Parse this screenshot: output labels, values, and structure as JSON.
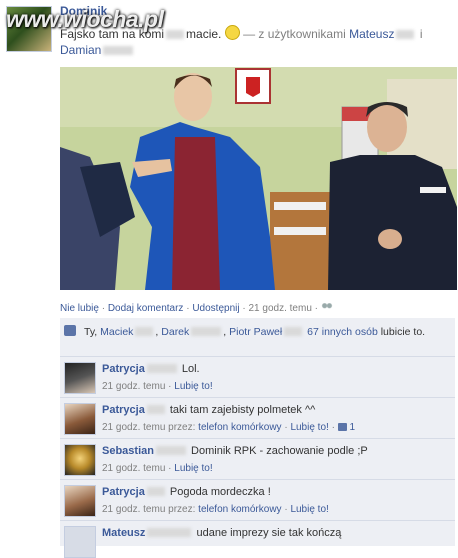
{
  "watermark": "www.wiocha.pl",
  "post": {
    "author": "Dominik",
    "text_start": "Fajsko tam na komi",
    "text_end": "macie.",
    "with_text": "— z użytkownikami",
    "tagged_1": "Mateusz",
    "tagged_sep": "i",
    "tagged_2": "Damian"
  },
  "actions": {
    "unlike": "Nie lubię",
    "sep1": "·",
    "comment": "Dodaj komentarz",
    "sep2": "·",
    "share": "Udostępnij",
    "sep3": "·",
    "time": "21 godz. temu",
    "sep4": "·"
  },
  "likes": {
    "prefix": "Ty,",
    "person_1": "Maciek",
    "person_2": "Darek",
    "person_3": "Piotr Paweł",
    "others": "67 innych osób",
    "suffix": "lubicie to."
  },
  "comments": [
    {
      "author": "Patrycja",
      "text": "Lol.",
      "time": "21 godz. temu",
      "via": "",
      "like": "Lubię to!",
      "like_count": ""
    },
    {
      "author": "Patrycja",
      "text": "taki tam zajebisty polmetek ^^",
      "time": "21 godz. temu przez:",
      "via": "telefon komórkowy",
      "like": "Lubię to!",
      "like_count": "1"
    },
    {
      "author": "Sebastian",
      "text": "Dominik RPK - zachowanie podle ;P",
      "time": "21 godz. temu",
      "via": "",
      "like": "Lubię to!",
      "like_count": ""
    },
    {
      "author": "Patrycja",
      "text": "Pogoda mordeczka !",
      "time": "21 godz. temu przez:",
      "via": "telefon komórkowy",
      "like": "Lubię to!",
      "like_count": ""
    },
    {
      "author": "Mateusz",
      "text": "udane imprezy sie tak kończą",
      "time": "",
      "via": "",
      "like": "",
      "like_count": ""
    }
  ],
  "colors": {
    "link": "#3b5998",
    "feedback_bg": "#edeff4",
    "muted": "#7f7f7f"
  }
}
